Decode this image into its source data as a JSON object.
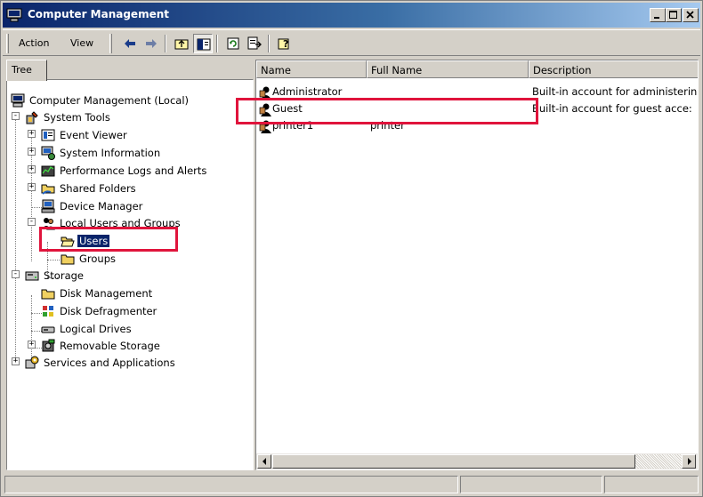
{
  "window": {
    "title": "Computer Management"
  },
  "menu": {
    "action": "Action",
    "view": "View"
  },
  "tab": {
    "label": "Tree"
  },
  "tree": {
    "items": [
      {
        "label": "Computer Management (Local)",
        "icon": "computer-icon"
      },
      {
        "label": "System Tools",
        "icon": "tools-icon"
      },
      {
        "label": "Event Viewer",
        "icon": "event-viewer-icon"
      },
      {
        "label": "System Information",
        "icon": "system-information-icon"
      },
      {
        "label": "Performance Logs and Alerts",
        "icon": "performance-icon"
      },
      {
        "label": "Shared Folders",
        "icon": "shared-folder-icon"
      },
      {
        "label": "Device Manager",
        "icon": "device-manager-icon"
      },
      {
        "label": "Local Users and Groups",
        "icon": "users-groups-icon"
      },
      {
        "label": "Users",
        "icon": "open-folder-icon",
        "selected": true
      },
      {
        "label": "Groups",
        "icon": "folder-icon"
      },
      {
        "label": "Storage",
        "icon": "storage-icon"
      },
      {
        "label": "Disk Management",
        "icon": "folder-icon"
      },
      {
        "label": "Disk Defragmenter",
        "icon": "defragmenter-icon"
      },
      {
        "label": "Logical Drives",
        "icon": "drive-icon"
      },
      {
        "label": "Removable Storage",
        "icon": "removable-storage-icon"
      },
      {
        "label": "Services and Applications",
        "icon": "services-icon"
      }
    ]
  },
  "list": {
    "columns": [
      "Name",
      "Full Name",
      "Description"
    ],
    "rows": [
      {
        "name": "Administrator",
        "full_name": "",
        "description": "Built-in account for administerin"
      },
      {
        "name": "Guest",
        "full_name": "",
        "description": "Built-in account for guest acce:"
      },
      {
        "name": "printer1",
        "full_name": "printer",
        "description": ""
      }
    ]
  },
  "colors": {
    "title_start": "#0a246a",
    "title_end": "#a6caf0",
    "highlight": "#e0143c",
    "selection": "#0a246a"
  }
}
